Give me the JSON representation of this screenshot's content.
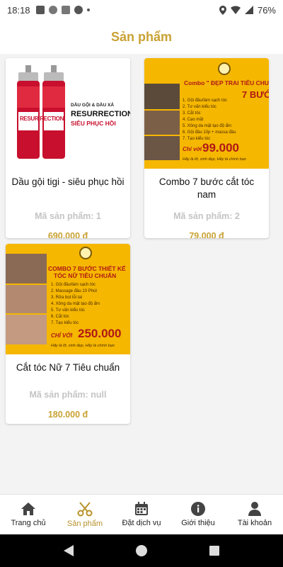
{
  "status_bar": {
    "time": "18:18",
    "battery": "76%"
  },
  "header": {
    "title": "Sản phẩm"
  },
  "products": [
    {
      "title": "Dầu gội tigi - siêu phục hồi",
      "code": "Mã sản phẩm: 1",
      "price": "690.000 đ",
      "image": {
        "line1": "DẦU GỘI & DẦU XẢ",
        "line2": "RESURRECTION™",
        "line3": "SIÊU PHỤC HỒI",
        "bottle": "RESUR RECTION"
      }
    },
    {
      "title": "Combo 7 bước cắt tóc nam",
      "code": "Mã sản phẩm: 2",
      "price": "79.000 đ",
      "image": {
        "heading": "Combo \" ĐẸP TRAI TIÊU CHUẨ",
        "steps_label": "7 BƯỚ",
        "steps": [
          "1. Gội đầu/làm sạch tóc",
          "2. Tư vấn kiểu tóc",
          "3. Cắt tóc",
          "4. Cạo mặt",
          "5. Xông da mặt tạo độ ẩm",
          "6. Gội đầu 10p + massa đầu",
          "7. Tạo kiểu tóc"
        ],
        "price_prefix": "Chỉ với",
        "price": "99.000",
        "slogan": "Hãy là lỡ, sinh đẹp, Hãy là chính bạn"
      }
    },
    {
      "title": "Cắt tóc Nữ 7 Tiêu chuẩn",
      "code": "Mã sản phẩm: null",
      "price": "180.000 đ",
      "image": {
        "heading1": "COMBO 7 BƯỚC THIẾT KẾ",
        "heading2": "TÓC NỮ TIÊU CHUẨN",
        "steps": [
          "1. Gội đầu/làm sạch tóc",
          "2. Massage đầu 10 Phút",
          "3. Rửa bọt lỗi tai",
          "4. Xông da mặt tạo độ ẩm",
          "5. Tư vấn kiểu tóc",
          "6. Cắt tóc",
          "7. Tạo kiểu tóc"
        ],
        "price_prefix": "CHỈ VỚI",
        "price": "250.000",
        "slogan": "Hãy là lỡ, sinh đẹp, Hãy là chính bạn"
      }
    }
  ],
  "bottom_nav": [
    {
      "label": "Trang chủ",
      "icon": "home-icon"
    },
    {
      "label": "Sản phẩm",
      "icon": "scissors-icon",
      "active": true
    },
    {
      "label": "Đặt dịch vụ",
      "icon": "calendar-icon"
    },
    {
      "label": "Giới thiệu",
      "icon": "info-icon"
    },
    {
      "label": "Tài khoản",
      "icon": "user-icon"
    }
  ],
  "colors": {
    "accent": "#c9a233",
    "promo_yellow": "#f5b700",
    "product_red": "#c8102e"
  }
}
